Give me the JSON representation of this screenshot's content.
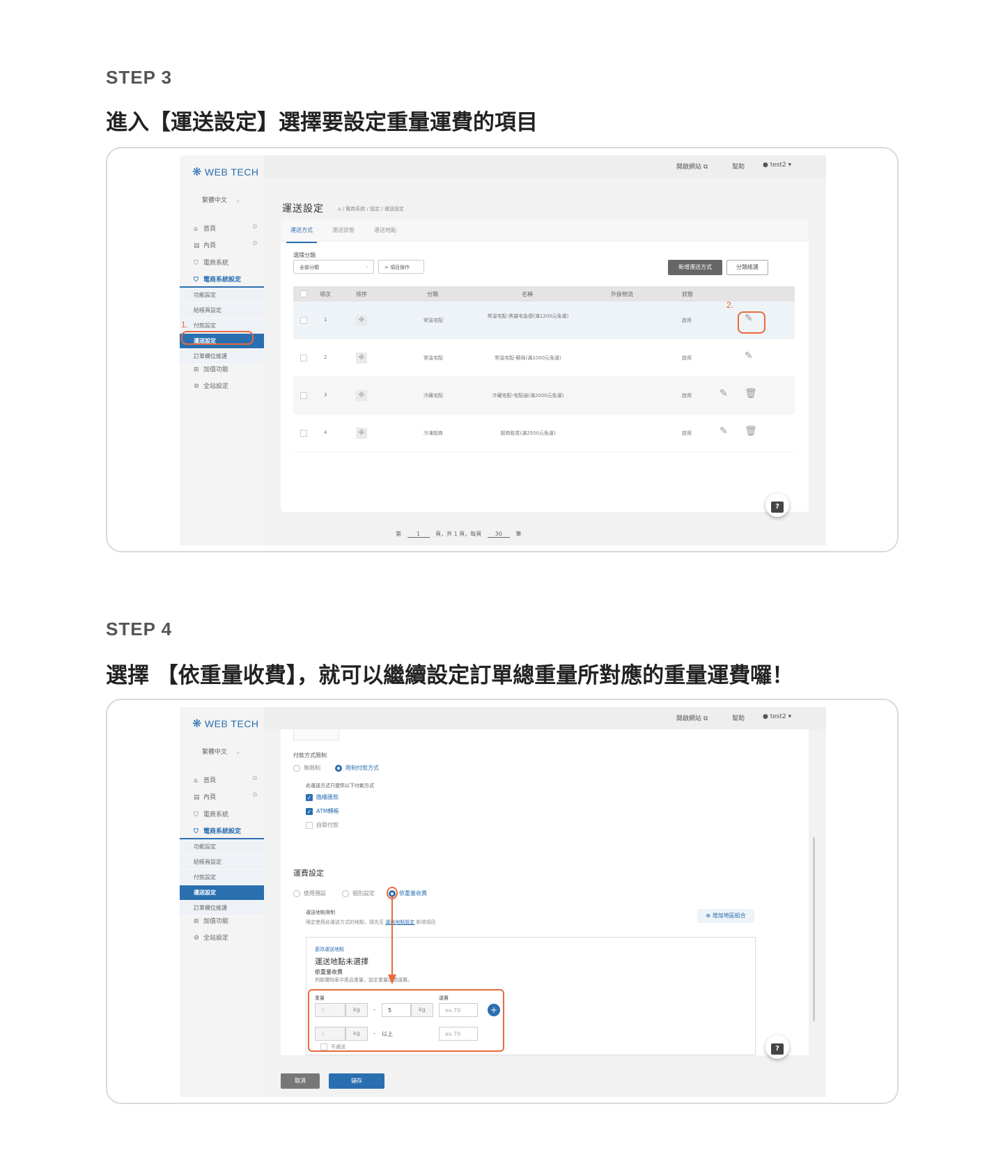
{
  "step3": {
    "label": "STEP 3",
    "title": "進入【運送設定】選擇要設定重量運費的項目"
  },
  "step4": {
    "label": "STEP 4",
    "title": "選擇 【依重量收費】，就可以繼續設定訂單總重量所對應的重量運費囉！"
  },
  "app": {
    "logo": "WEB TECH",
    "language": "繁體中文",
    "topbar": {
      "open_site": "開啟網站",
      "help": "幫助",
      "user": "test2"
    },
    "nav": [
      {
        "label": "首頁",
        "icon": "home-icon"
      },
      {
        "label": "內頁",
        "icon": "document-icon"
      },
      {
        "label": "電商系統",
        "icon": "cart-icon"
      },
      {
        "label": "電商系統設定",
        "icon": "cart-icon"
      }
    ],
    "subnav": [
      "功能設定",
      "結帳頁設定",
      "付款設定",
      "運送設定",
      "訂單欄位維護"
    ],
    "nav_bottom": [
      {
        "label": "加值功能",
        "icon": "gift-icon"
      },
      {
        "label": "全站設定",
        "icon": "gear-icon"
      }
    ]
  },
  "shipping": {
    "title": "運送設定",
    "breadcrumb": "/ 電商系統 / 設定 / 運送設定",
    "tabs": [
      "運送方式",
      "運送狀態",
      "運送地點"
    ],
    "category_label": "選擇分類",
    "category_value": "全部分類",
    "item_action": "> 項目操作",
    "add_button": "新增運送方式",
    "category_maint": "分類維護",
    "columns": [
      "項次",
      "排序",
      "分類",
      "名稱",
      "外掛物流",
      "狀態"
    ],
    "rows": [
      {
        "no": "1",
        "category": "常溫宅配",
        "name": "常溫宅配-黑貓宅急便(滿1200元免運)",
        "status": "啟用"
      },
      {
        "no": "2",
        "category": "常溫宅配",
        "name": "常溫宅配-郵局(滿1000元免運)",
        "status": "啟用"
      },
      {
        "no": "3",
        "category": "冷藏宅配",
        "name": "冷藏宅配-宅配通(滿2000元免運)",
        "status": "啟用"
      },
      {
        "no": "4",
        "category": "冷凍超商",
        "name": "超商取貨(滿2500元免運)",
        "status": "啟用"
      }
    ],
    "pager": {
      "prefix": "第",
      "page": "1",
      "middle": "頁，共 1 頁，每頁",
      "per_page": "30",
      "suffix": "筆"
    },
    "annotation_1": "1.",
    "annotation_2": "2."
  },
  "edit": {
    "payment_limit_label": "付款方式限制",
    "payment_options": [
      "無限制",
      "限制付款方式"
    ],
    "payment_note": "此運送方式只提供以下付款方式",
    "payments": [
      {
        "label": "臨櫃匯款",
        "checked": true
      },
      {
        "label": "ATM轉帳",
        "checked": true
      },
      {
        "label": "自取付款",
        "checked": false
      }
    ],
    "fee_title": "運費設定",
    "fee_options": [
      "使用預設",
      "個別設定",
      "依重量收費"
    ],
    "zone_limit_label": "運送地點限制",
    "zone_limit_note_a": "限定使用此運送方式的地點，請先至",
    "zone_limit_link": "運送地點設定",
    "zone_limit_note_b": "新增項目",
    "add_zone_button": "增加地區組合",
    "change_zone": "更改運送地點",
    "zone_unselected": "運送地點未選擇",
    "by_weight": "依重量收費",
    "by_weight_note": "判斷購物車中產品重量，設定重量區間運費。",
    "weight_label": "重量",
    "fee_label": "運費",
    "row1": {
      "from": "0",
      "unit": "kg",
      "dash": "-",
      "to": "5",
      "unit2": "kg",
      "fee_ph": "ex.70"
    },
    "row2": {
      "from": "5",
      "unit": "kg",
      "dash": "-",
      "above": "以上",
      "fee_ph": "ex.70"
    },
    "no_ship": "不運送",
    "cancel": "取消",
    "save": "儲存"
  }
}
